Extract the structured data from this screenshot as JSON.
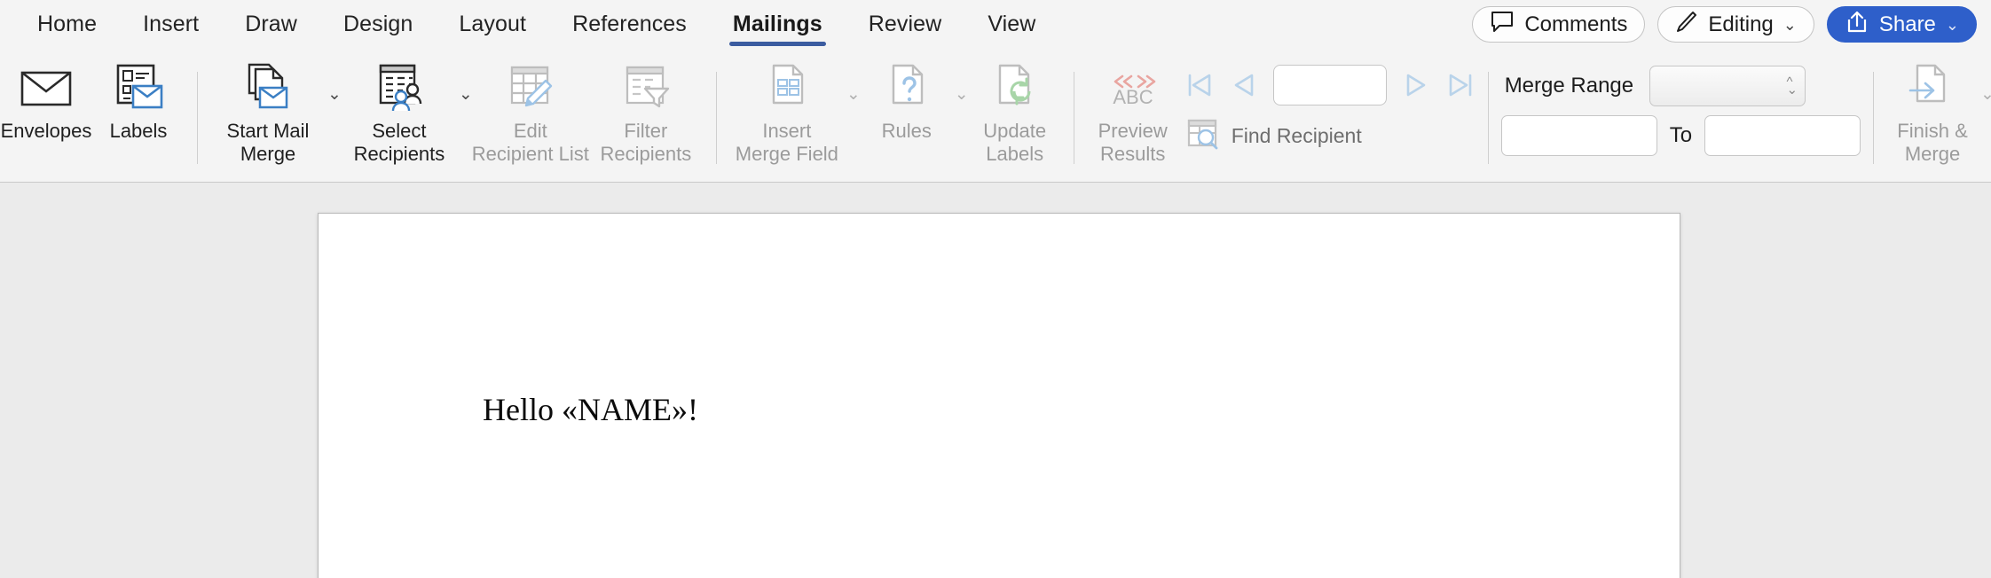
{
  "tabs": [
    {
      "label": "Home",
      "active": false
    },
    {
      "label": "Insert",
      "active": false
    },
    {
      "label": "Draw",
      "active": false
    },
    {
      "label": "Design",
      "active": false
    },
    {
      "label": "Layout",
      "active": false
    },
    {
      "label": "References",
      "active": false
    },
    {
      "label": "Mailings",
      "active": true
    },
    {
      "label": "Review",
      "active": false
    },
    {
      "label": "View",
      "active": false
    }
  ],
  "titlebar": {
    "comments_label": "Comments",
    "editing_label": "Editing",
    "share_label": "Share",
    "chevron": "⌄"
  },
  "colors": {
    "accent_tab_underline": "#3b5ca0",
    "share_button": "#2e5fca",
    "ribbon_background": "#f4f4f4",
    "canvas_background": "#ebebeb",
    "page_background": "#ffffff",
    "disabled_text": "#9b9b9b",
    "icon_blue": "#3b7fc4",
    "icon_grey": "#8f8f8f"
  },
  "ribbon": {
    "groups": [
      {
        "name": "create",
        "buttons": [
          {
            "label": "Envelopes",
            "icon": "envelope-icon",
            "disabled": false,
            "dropdown": false
          },
          {
            "label": "Labels",
            "icon": "labels-icon",
            "disabled": false,
            "dropdown": false
          }
        ]
      },
      {
        "name": "start-mail-merge",
        "buttons": [
          {
            "label": "Start Mail\nMerge",
            "icon": "start-mail-merge-icon",
            "disabled": false,
            "dropdown": true
          },
          {
            "label": "Select\nRecipients",
            "icon": "select-recipients-icon",
            "disabled": false,
            "dropdown": true
          },
          {
            "label": "Edit\nRecipient List",
            "icon": "edit-recipient-list-icon",
            "disabled": true,
            "dropdown": false
          },
          {
            "label": "Filter\nRecipients",
            "icon": "filter-recipients-icon",
            "disabled": true,
            "dropdown": false
          }
        ]
      },
      {
        "name": "write-insert-fields",
        "buttons": [
          {
            "label": "Insert\nMerge Field",
            "icon": "insert-merge-field-icon",
            "disabled": true,
            "dropdown": true
          },
          {
            "label": "Rules",
            "icon": "rules-icon",
            "disabled": true,
            "dropdown": true
          },
          {
            "label": "Update\nLabels",
            "icon": "update-labels-icon",
            "disabled": true,
            "dropdown": false
          }
        ]
      },
      {
        "name": "preview-results",
        "buttons": [
          {
            "label": "Preview\nResults",
            "icon": "preview-results-abc-icon",
            "disabled": true,
            "dropdown": false
          }
        ]
      }
    ],
    "navigation": {
      "first_record_label": "first-record",
      "previous_record_label": "previous-record",
      "next_record_label": "next-record",
      "last_record_label": "last-record",
      "record_number_value": "",
      "record_number_placeholder": "",
      "find_recipient_label": "Find Recipient"
    },
    "merge_range": {
      "label": "Merge Range",
      "dropdown_value": "",
      "from_value": "",
      "to_label": "To",
      "to_value": ""
    },
    "finish": {
      "label": "Finish &\nMerge",
      "icon": "finish-and-merge-icon",
      "disabled": true,
      "dropdown": true
    }
  },
  "document": {
    "body_text": "Hello «NAME»!"
  }
}
